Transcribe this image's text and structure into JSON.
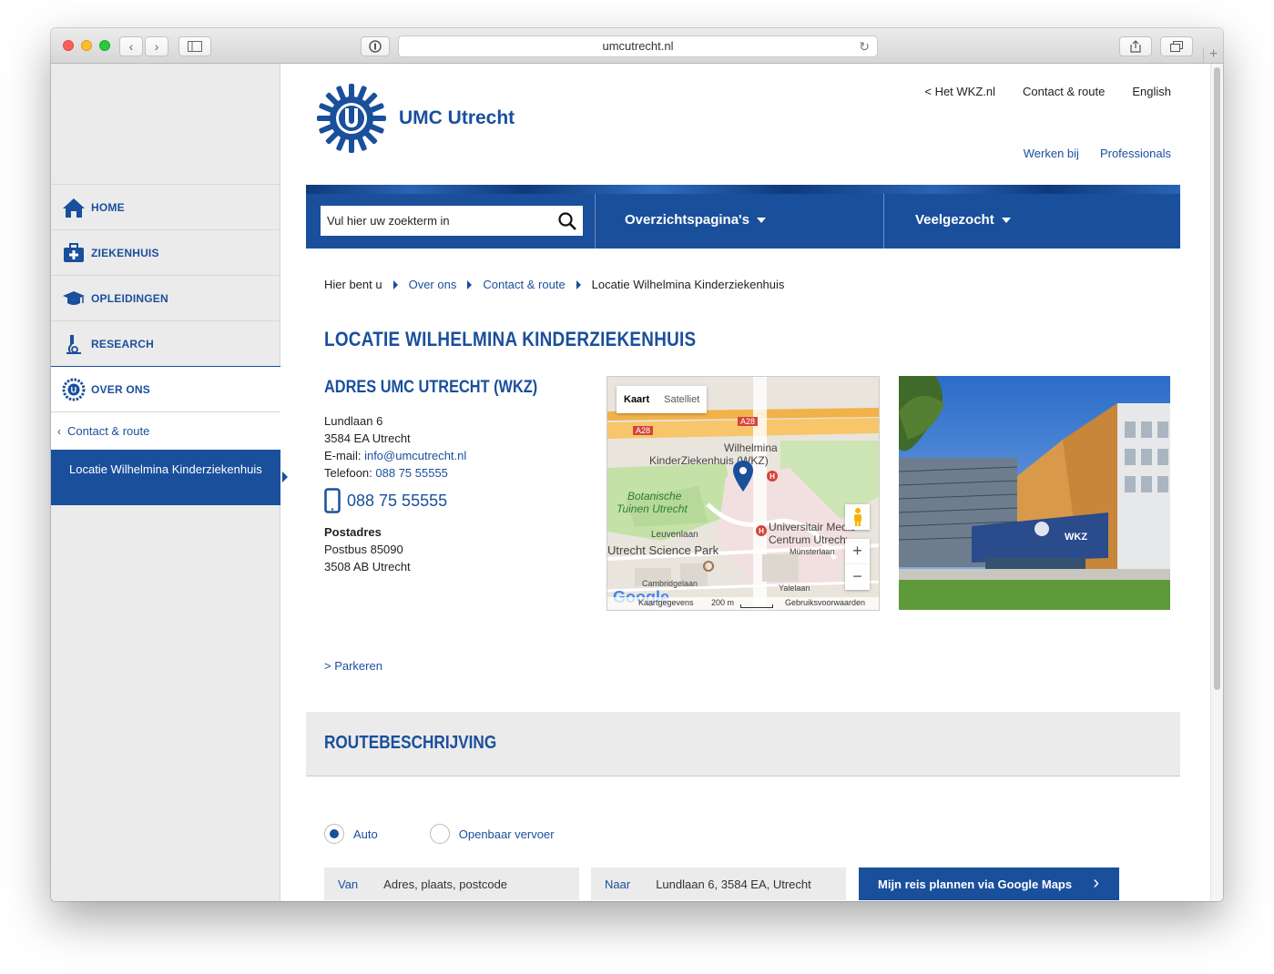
{
  "browser": {
    "url": "umcutrecht.nl"
  },
  "sidebar": {
    "items": [
      {
        "label": "HOME"
      },
      {
        "label": "ZIEKENHUIS"
      },
      {
        "label": "OPLEIDINGEN"
      },
      {
        "label": "RESEARCH"
      },
      {
        "label": "OVER ONS"
      }
    ],
    "sub_item": "Contact & route",
    "current": "Locatie Wilhelmina Kinderziekenhuis"
  },
  "header": {
    "logo_text": "UMC Utrecht",
    "links_top": [
      "< Het WKZ.nl",
      "Contact & route",
      "English"
    ],
    "links_bottom": [
      "Werken bij",
      "Professionals"
    ]
  },
  "navbar": {
    "search_placeholder": "Vul hier uw zoekterm in",
    "dropdown1": "Overzichtspagina's",
    "dropdown2": "Veelgezocht"
  },
  "breadcrumb": {
    "prefix": "Hier bent u",
    "items": [
      "Over ons",
      "Contact & route",
      "Locatie Wilhelmina Kinderziekenhuis"
    ]
  },
  "page": {
    "title": "LOCATIE WILHELMINA KINDERZIEKENHUIS",
    "address_heading": "ADRES UMC UTRECHT (WKZ)",
    "street": "Lundlaan 6",
    "city": "3584 EA Utrecht",
    "email_label": "E-mail:",
    "email": "info@umcutrecht.nl",
    "phone_label": "Telefoon:",
    "phone": "088 75 55555",
    "phone_big": "088 75 55555",
    "postadres_label": "Postadres",
    "postbus": "Postbus 85090",
    "post_city": "3508 AB Utrecht",
    "parkeren": "> Parkeren"
  },
  "map": {
    "tab_map": "Kaart",
    "tab_sat": "Satelliet",
    "labels": [
      "A28",
      "A28",
      "Wilhelmina",
      "KinderZiekenhuis (WKZ)",
      "Botanische",
      "Tuinen Utrecht",
      "Leuvenlaan",
      "Universitair Medisch",
      "Centrum Utrecht",
      "Utrecht Science Park",
      "Münsterlaan",
      "Cambridgelaan",
      "Yalelaan"
    ],
    "google": "Google",
    "footer_data": "Kaartgegevens",
    "footer_scale": "200 m",
    "footer_terms": "Gebruiksvoorwaarden"
  },
  "route": {
    "title": "ROUTEBESCHRIJVING",
    "option_auto": "Auto",
    "option_ov": "Openbaar vervoer",
    "from_label": "Van",
    "from_placeholder": "Adres, plaats, postcode",
    "to_label": "Naar",
    "to_value": "Lundlaan 6, 3584 EA, Utrecht",
    "button": "Mijn reis plannen via Google Maps"
  },
  "colors": {
    "brand_blue": "#1a4f9c",
    "sidebar_bg": "#ebebeb"
  }
}
